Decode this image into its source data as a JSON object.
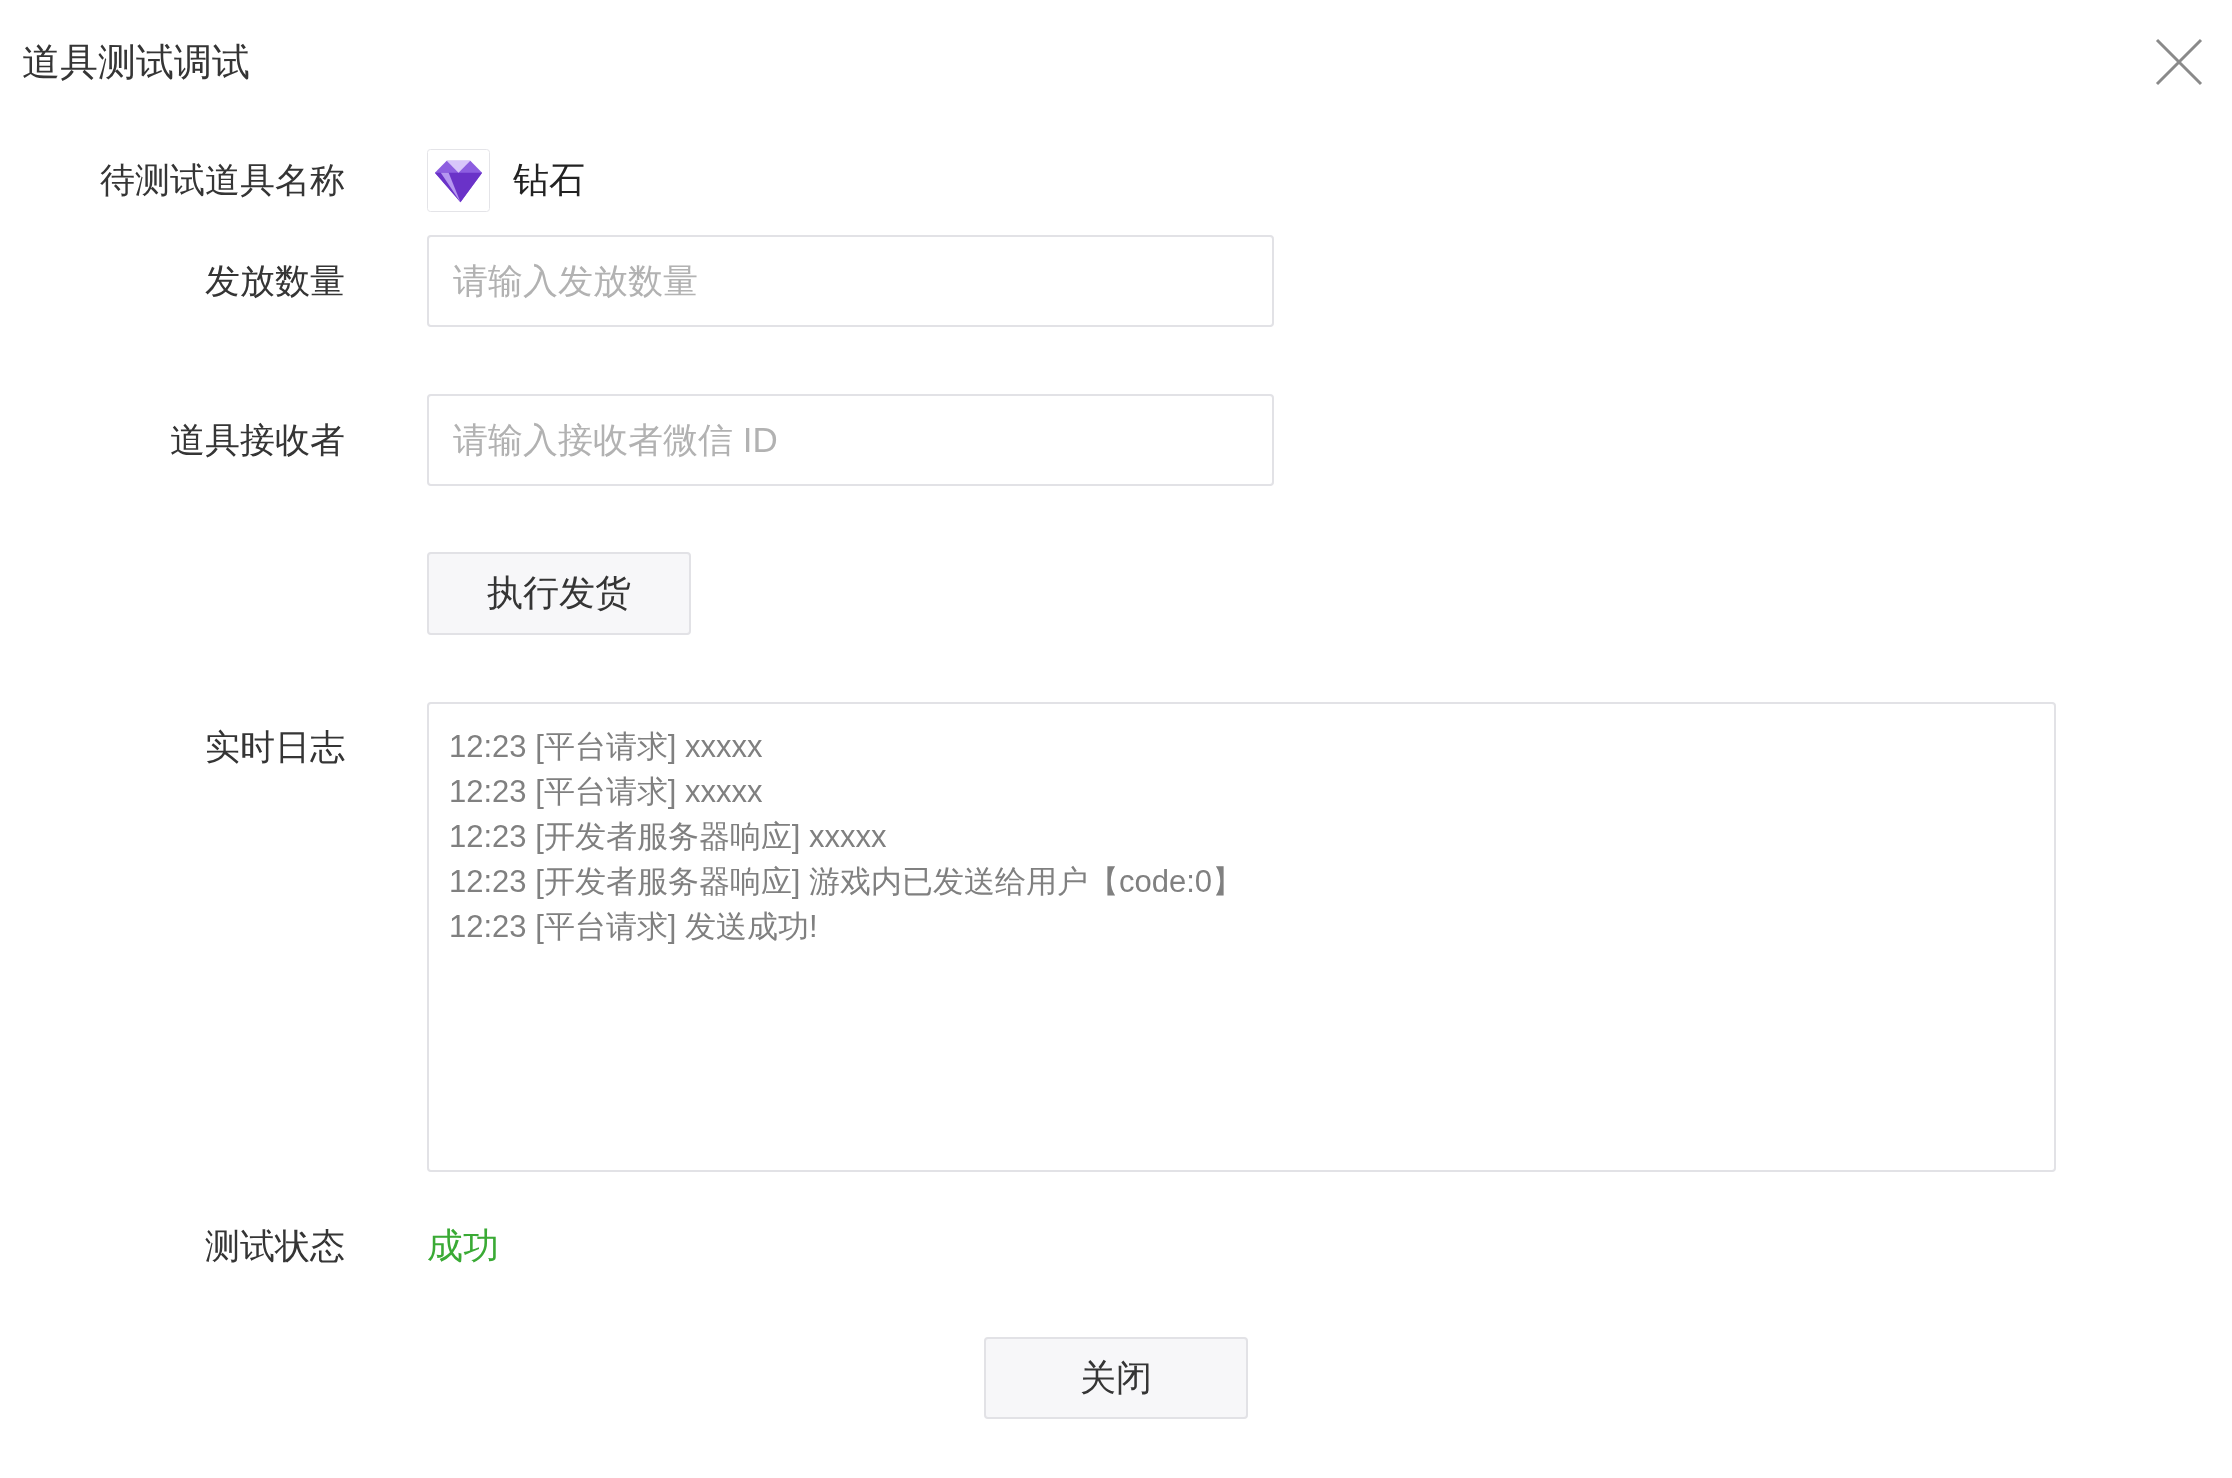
{
  "dialog": {
    "title": "道具测试调试"
  },
  "item": {
    "label": "待测试道具名称",
    "name": "钻石"
  },
  "quantity": {
    "label": "发放数量",
    "placeholder": "请输入发放数量"
  },
  "receiver": {
    "label": "道具接收者",
    "placeholder": "请输入接收者微信 ID"
  },
  "execute_button": "执行发货",
  "log": {
    "label": "实时日志",
    "lines": [
      "12:23 [平台请求] xxxxx",
      "12:23 [平台请求] xxxxx",
      "12:23 [开发者服务器响应] xxxxx",
      "12:23 [开发者服务器响应] 游戏内已发送给用户【code:0】",
      "12:23 [平台请求] 发送成功!"
    ]
  },
  "status": {
    "label": "测试状态",
    "value": "成功",
    "kind": "success"
  },
  "close_button": "关闭"
}
